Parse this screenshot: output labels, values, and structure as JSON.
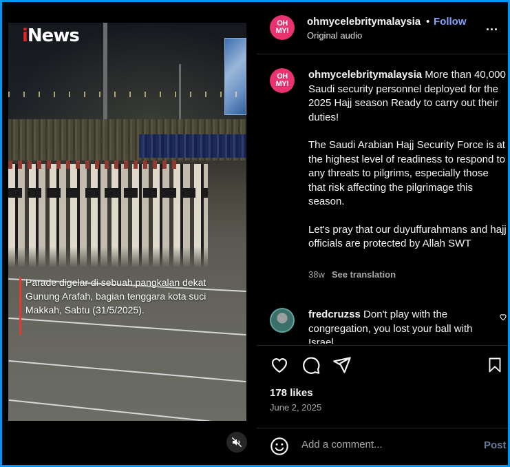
{
  "video": {
    "brand_logo": {
      "prefix": "i",
      "rest": "News"
    },
    "overlay_caption": "Parade digelar di sebuah pangkalan dekat Gunung Arafah, bagian tenggara kota suci Makkah, Sabtu (31/5/2025).",
    "mute_icon": "speaker-muted-icon"
  },
  "header": {
    "avatar_text": "OH MY!",
    "username": "ohmycelebritymalaysia",
    "separator": "•",
    "follow_label": "Follow",
    "audio_label": "Original audio",
    "more_label": "..."
  },
  "post": {
    "username": "ohmycelebritymalaysia",
    "paragraphs": [
      "More than 40,000 Saudi security personnel deployed for the 2025 Hajj season Ready to carry out their duties!",
      "The Saudi Arabian Hajj Security Force is at the highest level of readiness to respond to any threats to pilgrims, especially those that risk affecting the pilgrimage this season.",
      "Let's pray that our duyuffurahmans and hajj officials are protected by Allah SWT"
    ],
    "age": "38w",
    "see_translation": "See translation"
  },
  "comment": {
    "username": "fredcruzss",
    "text": "Don't play with the congregation, you lost your ball with Israel"
  },
  "actions": {
    "icons": [
      "heart-icon",
      "comment-icon",
      "share-icon",
      "bookmark-icon"
    ]
  },
  "stats": {
    "likes": "178 likes",
    "date": "June 2, 2025"
  },
  "add_comment": {
    "placeholder": "Add a comment...",
    "post_label": "Post"
  },
  "colors": {
    "border": "#0095f6",
    "follow": "#85a1ff",
    "avatar": "#e8336f",
    "caption_bar": "#e43a2f"
  }
}
